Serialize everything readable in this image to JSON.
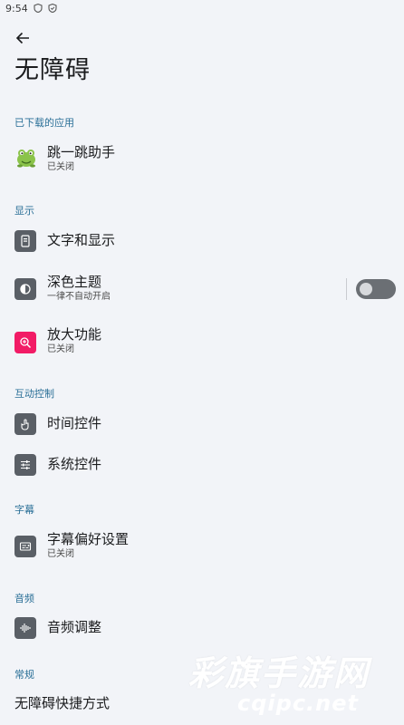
{
  "status_bar": {
    "time": "9:54"
  },
  "page": {
    "title": "无障碍"
  },
  "sections": {
    "downloaded": "已下载的应用",
    "display": "显示",
    "interaction": "互动控制",
    "captions": "字幕",
    "audio": "音频",
    "general": "常规"
  },
  "items": {
    "jump_helper": {
      "title": "跳一跳助手",
      "subtitle": "已关闭"
    },
    "text_display": {
      "title": "文字和显示"
    },
    "dark_theme": {
      "title": "深色主题",
      "subtitle": "一律不自动开启",
      "toggle_on": false
    },
    "magnification": {
      "title": "放大功能",
      "subtitle": "已关闭"
    },
    "timing_controls": {
      "title": "时间控件"
    },
    "system_controls": {
      "title": "系统控件"
    },
    "caption_prefs": {
      "title": "字幕偏好设置",
      "subtitle": "已关闭"
    },
    "audio_adjust": {
      "title": "音频调整"
    },
    "shortcuts": {
      "title": "无障碍快捷方式"
    }
  },
  "watermark": {
    "main": "彩旗手游网",
    "url": "cqipc.net"
  },
  "colors": {
    "background": "#f2f4f8",
    "section_header": "#2a6f97",
    "icon_dark": "#5a5f66",
    "icon_magnify": "#f21b66",
    "toggle_off": "#6b6f74"
  }
}
